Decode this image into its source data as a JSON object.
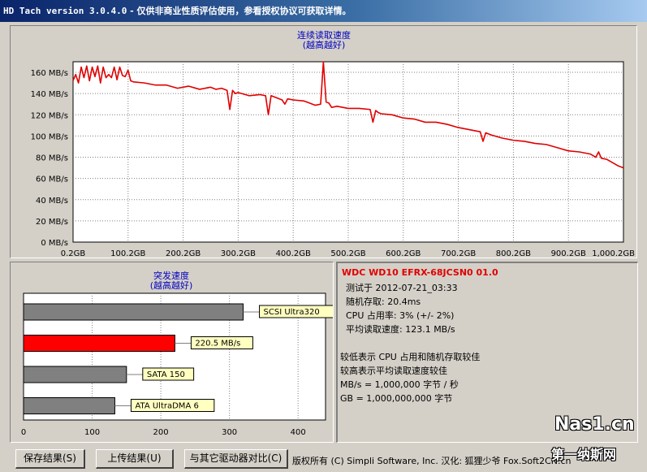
{
  "window": {
    "title_app": "HD Tach version 3.0.4.0",
    "title_note": " - 仅供非商业性质评估使用，参看授权协议可获取详情。"
  },
  "sequential": {
    "title": "连续读取速度",
    "subtitle": "(越高越好)",
    "color": "#e00000"
  },
  "burst": {
    "title": "突发速度",
    "subtitle": "(越高越好)"
  },
  "chart_data": [
    {
      "type": "line",
      "title": "连续读取速度",
      "subtitle": "(越高越好)",
      "xlabel": "",
      "ylabel": "",
      "xlim": [
        0.2,
        1000.2
      ],
      "ylim": [
        0,
        170
      ],
      "grid": true,
      "x_ticks": [
        "0.2GB",
        "100.2GB",
        "200.2GB",
        "300.2GB",
        "400.2GB",
        "500.2GB",
        "600.2GB",
        "700.2GB",
        "800.2GB",
        "900.2GB",
        "1,000.2GB"
      ],
      "y_ticks": [
        "0 MB/s",
        "20 MB/s",
        "40 MB/s",
        "60 MB/s",
        "80 MB/s",
        "100 MB/s",
        "120 MB/s",
        "140 MB/s",
        "160 MB/s"
      ],
      "series": [
        {
          "color": "#e00000",
          "x": [
            0,
            5,
            10,
            15,
            20,
            25,
            30,
            35,
            40,
            45,
            50,
            55,
            60,
            65,
            70,
            75,
            80,
            85,
            90,
            95,
            100,
            105,
            110,
            130,
            150,
            170,
            190,
            210,
            230,
            250,
            260,
            270,
            280,
            285,
            290,
            295,
            300,
            320,
            340,
            350,
            355,
            360,
            370,
            380,
            385,
            390,
            400,
            420,
            430,
            440,
            450,
            455,
            460,
            465,
            470,
            480,
            500,
            520,
            540,
            545,
            550,
            555,
            560,
            580,
            600,
            620,
            640,
            660,
            680,
            700,
            720,
            740,
            745,
            750,
            760,
            780,
            800,
            820,
            840,
            860,
            880,
            900,
            920,
            940,
            950,
            955,
            960,
            970,
            980,
            990,
            1000
          ],
          "y": [
            152,
            158,
            150,
            165,
            155,
            166,
            152,
            165,
            156,
            166,
            150,
            165,
            155,
            158,
            155,
            165,
            153,
            165,
            157,
            156,
            162,
            152,
            151,
            150,
            148,
            148,
            145,
            147,
            144,
            146,
            144,
            145,
            143,
            125,
            143,
            140,
            141,
            138,
            139,
            138,
            120,
            138,
            136,
            134,
            130,
            135,
            134,
            133,
            131,
            129,
            130,
            170,
            132,
            131,
            127,
            128,
            126,
            126,
            125,
            113,
            124,
            122,
            121,
            120,
            117,
            116,
            113,
            113,
            111,
            108,
            106,
            104,
            95,
            103,
            101,
            98,
            96,
            95,
            93,
            92,
            89,
            86,
            85,
            83,
            80,
            85,
            79,
            78,
            75,
            72,
            70
          ]
        }
      ]
    },
    {
      "type": "bar",
      "orientation": "horizontal",
      "title": "突发速度",
      "subtitle": "(越高越好)",
      "xlim": [
        0,
        440
      ],
      "x_ticks": [
        "0",
        "100",
        "200",
        "300",
        "400"
      ],
      "categories": [
        "SCSI Ultra320",
        "220.5 MB/s",
        "SATA 150",
        "ATA UltraDMA 6"
      ],
      "values": [
        320,
        220.5,
        150,
        133
      ],
      "colors": [
        "#808080",
        "#ff0000",
        "#808080",
        "#808080"
      ]
    }
  ],
  "info": {
    "drive": "WDC WD10 EFRX-68JCSN0 01.0",
    "tested": "测试于 2012-07-21_03:33",
    "random_access": "随机存取: 20.4ms",
    "cpu": "CPU 占用率: 3% (+/- 2%)",
    "avg_read": "平均读取速度: 123.1 MB/s",
    "legend1": "较低表示 CPU 占用和随机存取较佳",
    "legend2": "较高表示平均读取速度较佳",
    "unit_mb": "MB/s = 1,000,000 字节 / 秒",
    "unit_gb": "GB = 1,000,000,000 字节"
  },
  "buttons": {
    "save": "保存结果(S)",
    "upload": "上传结果(U)",
    "compare": "与其它驱动器对比(C)"
  },
  "footer": "版权所有 (C) Simpli Software, Inc. 汉化: 狐狸少爷 Fox.Soft2CN.cn",
  "watermark": {
    "top": "Nas1.cn",
    "bottom": "第一纳斯网"
  }
}
